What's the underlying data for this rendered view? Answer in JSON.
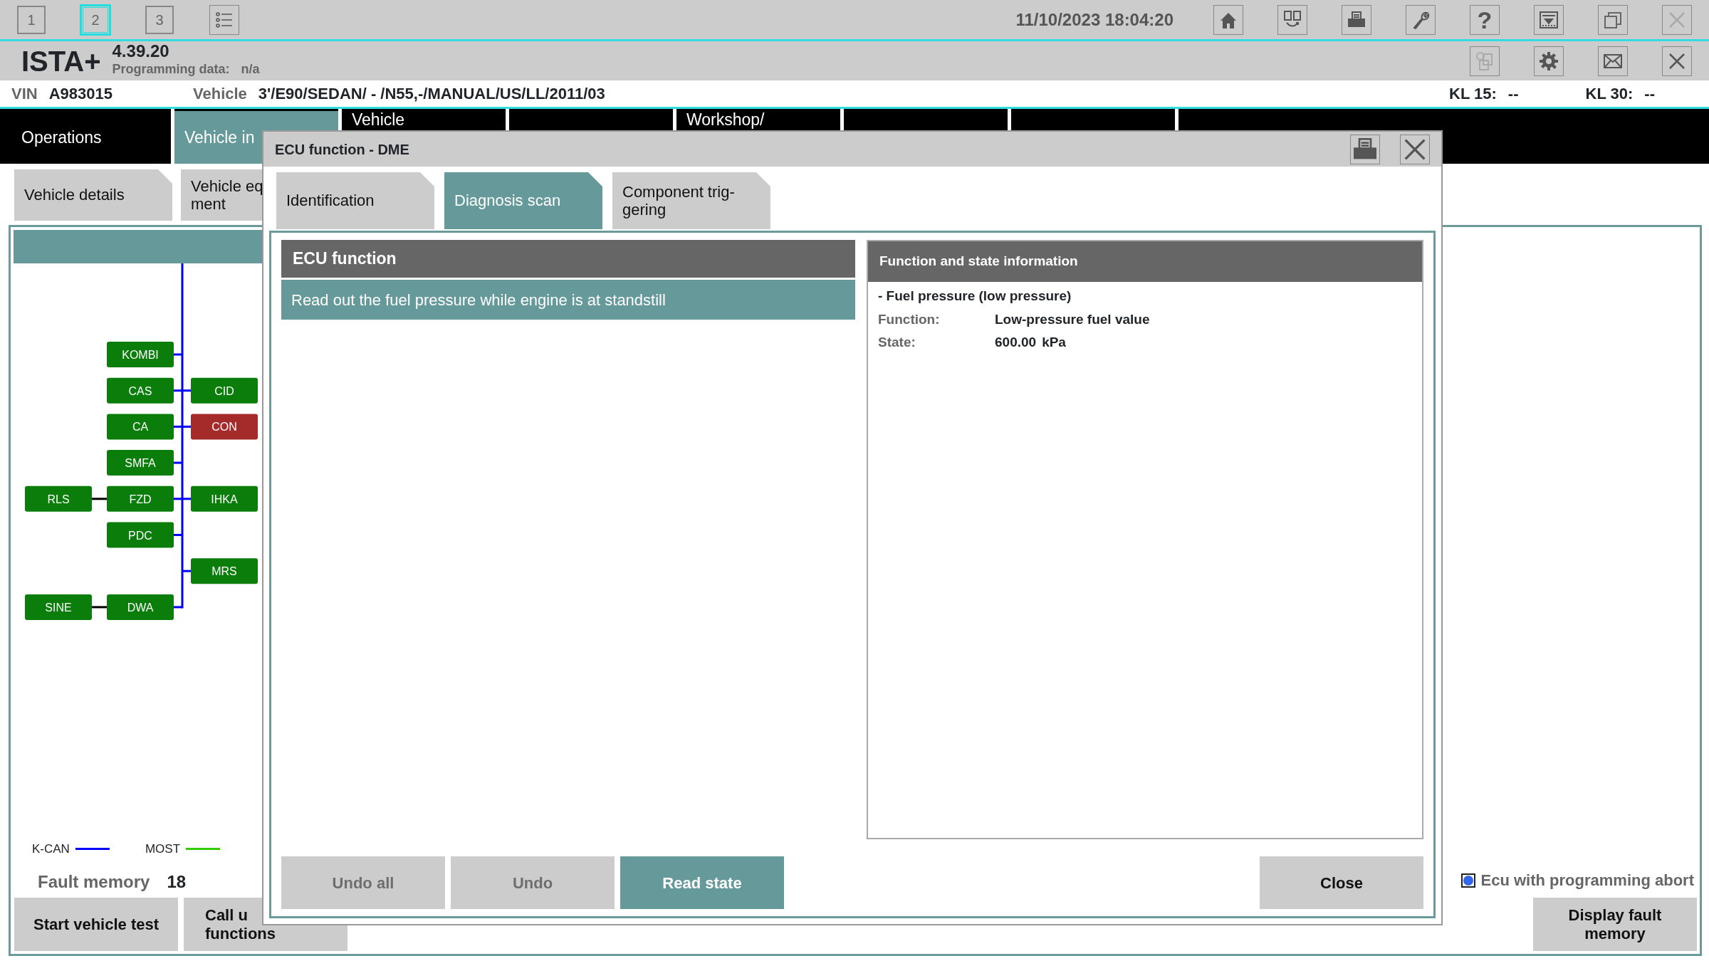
{
  "session_tabs": [
    {
      "label": "1",
      "selected": false
    },
    {
      "label": "2",
      "selected": true
    },
    {
      "label": "3",
      "selected": false
    }
  ],
  "datetime": "11/10/2023 18:04:20",
  "help_button": "?",
  "app": {
    "name": "ISTA+",
    "version": "4.39.20",
    "programming_label": "Programming data:",
    "programming_value": "n/a"
  },
  "vehicle_bar": {
    "vin_label": "VIN",
    "vin": "A983015",
    "vehicle_label": "Vehicle",
    "vehicle": "3'/E90/SEDAN/ - /N55,-/MANUAL/US/LL/2011/03",
    "kl15_label": "KL 15:",
    "kl15": "--",
    "kl30_label": "KL 30:",
    "kl30": "--"
  },
  "main_tabs": [
    {
      "label": "Operations",
      "selected": false
    },
    {
      "label": "Vehicle in",
      "selected": true
    },
    {
      "label": "Vehicle",
      "selected": false
    },
    {
      "label": "Workshop/",
      "selected": false
    }
  ],
  "sub_tabs": [
    {
      "lines": [
        "Vehicle details"
      ]
    },
    {
      "lines": [
        "Vehicle eq",
        "ment"
      ]
    }
  ],
  "network": {
    "rows": [
      {
        "center": {
          "label": "KOMBI",
          "color": "#0a7d0a"
        }
      },
      {
        "center": {
          "label": "CAS",
          "color": "#0a7d0a"
        },
        "right": {
          "label": "CID",
          "color": "#0a7d0a"
        }
      },
      {
        "center": {
          "label": "CA",
          "color": "#0a7d0a"
        },
        "right": {
          "label": "CON",
          "color": "#a52a2a"
        }
      },
      {
        "center": {
          "label": "SMFA",
          "color": "#0a7d0a"
        }
      },
      {
        "left": {
          "label": "RLS",
          "color": "#0a7d0a"
        },
        "center": {
          "label": "FZD",
          "color": "#0a7d0a"
        },
        "right": {
          "label": "IHKA",
          "color": "#0a7d0a"
        }
      },
      {
        "center": {
          "label": "PDC",
          "color": "#0a7d0a"
        }
      },
      {
        "right": {
          "label": "MRS",
          "color": "#0a7d0a"
        }
      },
      {
        "left": {
          "label": "SINE",
          "color": "#0a7d0a"
        },
        "center": {
          "label": "DWA",
          "color": "#0a7d0a"
        }
      }
    ]
  },
  "legend": [
    {
      "label": "K-CAN",
      "color": "#0000ff"
    },
    {
      "label": "MOST",
      "color": "#33cc00"
    }
  ],
  "fault_memory": {
    "label": "Fault memory",
    "count": "18"
  },
  "bottom_buttons": [
    {
      "lines": [
        "Start vehicle test"
      ]
    },
    {
      "lines": [
        "Call u",
        "functions"
      ]
    }
  ],
  "programming_abort": {
    "label": "Ecu with programming abort",
    "checked": true
  },
  "display_fault_memory": {
    "lines": [
      "Display fault",
      "memory"
    ]
  },
  "dialog": {
    "title": "ECU function - DME",
    "tabs": [
      {
        "lines": [
          "Identification"
        ],
        "selected": false
      },
      {
        "lines": [
          "Diagnosis scan"
        ],
        "selected": true
      },
      {
        "lines": [
          "Component trig-",
          "gering"
        ],
        "selected": false
      }
    ],
    "list_header": "ECU function",
    "functions": [
      {
        "label": "Read out the fuel pressure while engine is at standstill",
        "selected": true
      }
    ],
    "info": {
      "header": "Function and state information",
      "item": "- Fuel pressure (low pressure)",
      "fields": [
        {
          "label": "Function:",
          "value": "Low-pressure fuel value"
        },
        {
          "label": "State:",
          "value": "600.00",
          "unit": "kPa"
        }
      ]
    },
    "buttons": [
      {
        "label": "Undo all",
        "kind": "action",
        "disabled": true
      },
      {
        "label": "Undo",
        "kind": "action",
        "disabled": true
      },
      {
        "label": "Read state",
        "kind": "primary",
        "disabled": false
      },
      {
        "label": "Close",
        "kind": "close",
        "disabled": false
      }
    ]
  }
}
